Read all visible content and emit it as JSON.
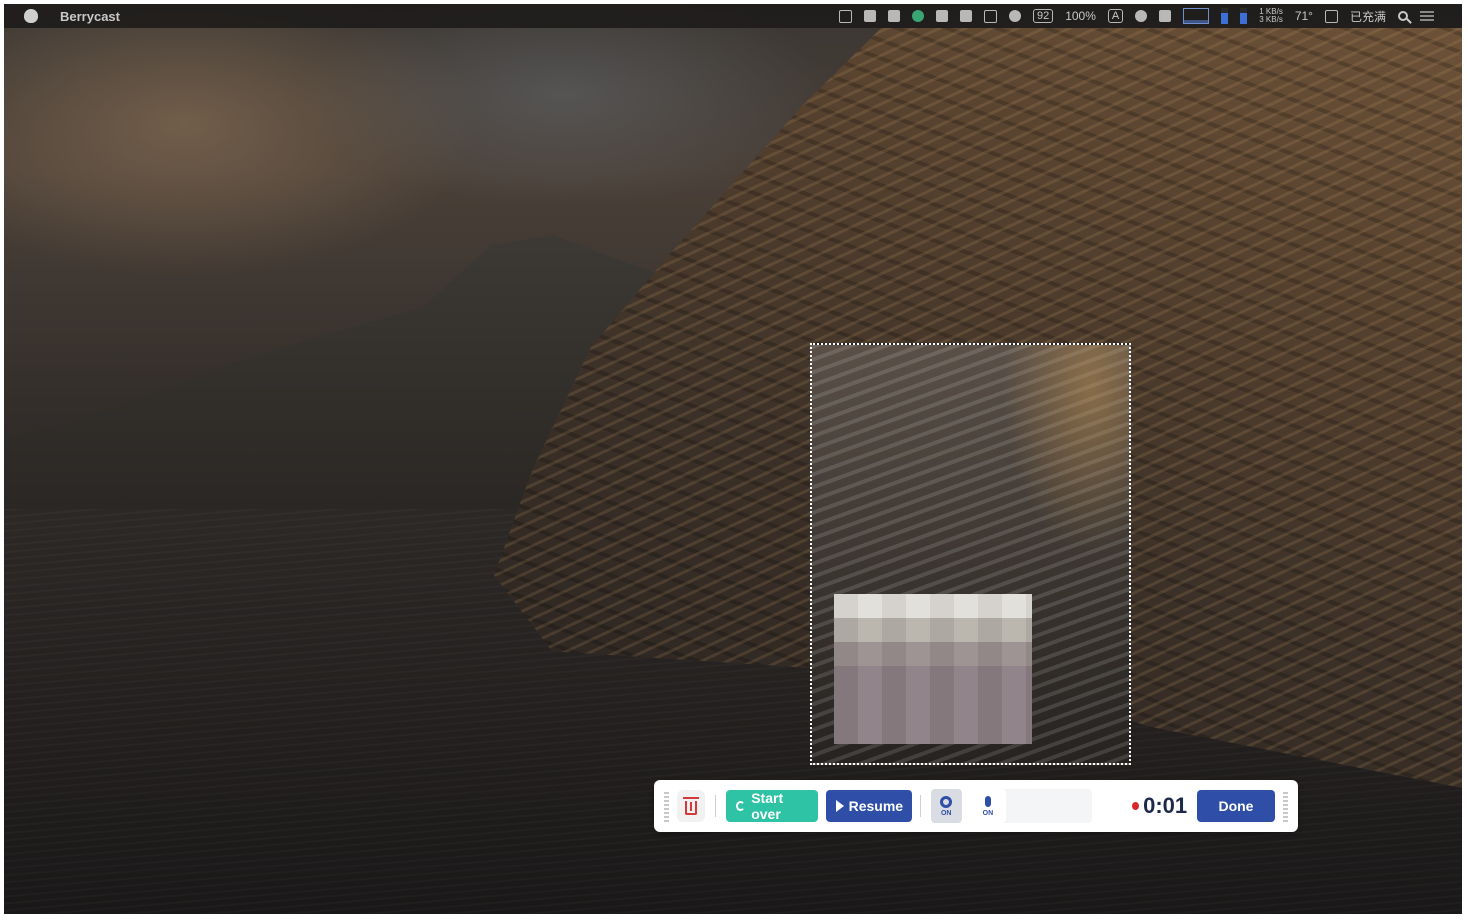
{
  "menubar": {
    "app_name": "Berrycast",
    "battery_label": "100%",
    "battery_level_text": "92",
    "input_source": "A",
    "net_up": "1 KB/s",
    "net_down": "3 KB/s",
    "temperature": "71°",
    "charging_status": "已充满"
  },
  "toolbar": {
    "start_over_label": "Start over",
    "resume_label": "Resume",
    "webcam_state": "ON",
    "mic_state": "ON",
    "timer": "0:01",
    "done_label": "Done"
  },
  "colors": {
    "start_over_bg": "#2fc3a5",
    "primary_blue": "#2f4ea8",
    "delete_red": "#d33a3a",
    "recording_dot": "#d9272b"
  }
}
